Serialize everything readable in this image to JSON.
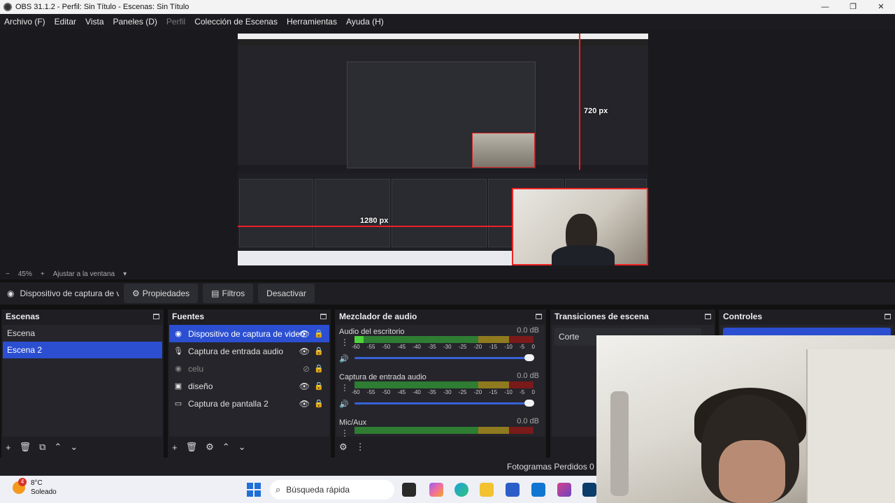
{
  "window": {
    "title": "OBS 31.1.2 - Perfil: Sin Título - Escenas: Sin Título",
    "controls": [
      "—",
      "❐",
      "✕"
    ]
  },
  "menu": {
    "items": [
      "Archivo (F)",
      "Editar",
      "Vista",
      "Paneles (D)",
      "Perfil",
      "Colección de Escenas",
      "Herramientas",
      "Ayuda (H)"
    ]
  },
  "preview": {
    "dim_height": "720 px",
    "dim_width": "1280 px"
  },
  "zoom": {
    "minus": "−",
    "value": "45%",
    "plus": "+",
    "fit_label": "Ajustar a la ventana",
    "dropdown": "▾"
  },
  "source_toolbar": {
    "selected_source": "Dispositivo de captura de v",
    "properties_label": "Propiedades",
    "filters_label": "Filtros",
    "deactivate_label": "Desactivar"
  },
  "scenes": {
    "title": "Escenas",
    "items": [
      {
        "label": "Escena",
        "selected": false
      },
      {
        "label": "Escena 2",
        "selected": true
      }
    ],
    "footer_icons": [
      "+",
      "🗑",
      "⧉",
      "⌃",
      "⌄"
    ]
  },
  "sources": {
    "title": "Fuentes",
    "items": [
      {
        "label": "Dispositivo de captura de video",
        "icon": "camera-icon",
        "glyph": "◉",
        "visible": true,
        "selected": true
      },
      {
        "label": "Captura de entrada audio",
        "icon": "microphone-icon",
        "glyph": "🎙",
        "visible": true,
        "selected": false
      },
      {
        "label": "celu",
        "icon": "camera-icon",
        "glyph": "◉",
        "visible": false,
        "selected": false
      },
      {
        "label": "diseño",
        "icon": "window-icon",
        "glyph": "▣",
        "visible": true,
        "selected": false
      },
      {
        "label": "Captura de pantalla 2",
        "icon": "monitor-icon",
        "glyph": "▭",
        "visible": true,
        "selected": false
      }
    ],
    "footer_icons": [
      "+",
      "🗑",
      "⚙",
      "⌃",
      "⌄"
    ]
  },
  "mixer": {
    "title": "Mezclador de audio",
    "scale": [
      "-60",
      "-55",
      "-50",
      "-45",
      "-40",
      "-35",
      "-30",
      "-25",
      "-20",
      "-15",
      "-10",
      "-5",
      "0"
    ],
    "channels": [
      {
        "name": "Audio del escritorio",
        "db": "0.0 dB",
        "level": 0.05
      },
      {
        "name": "Captura de entrada audio",
        "db": "0.0 dB",
        "level": 0
      },
      {
        "name": "Mic/Aux",
        "db": "0.0 dB",
        "level": 0
      }
    ],
    "footer_icons": [
      "⚙",
      "⋮"
    ]
  },
  "transitions": {
    "title": "Transiciones de escena",
    "current": "Corte"
  },
  "controls": {
    "title": "Controles"
  },
  "status": {
    "dropped_frames": "Fotogramas Perdidos 0 (0"
  },
  "taskbar": {
    "weather_temp": "8°C",
    "weather_desc": "Soleado",
    "weather_badge": "4",
    "search_label": "Búsqueda rápida"
  },
  "colors": {
    "accent": "#2b4fd0",
    "guide_red": "#e22222"
  }
}
